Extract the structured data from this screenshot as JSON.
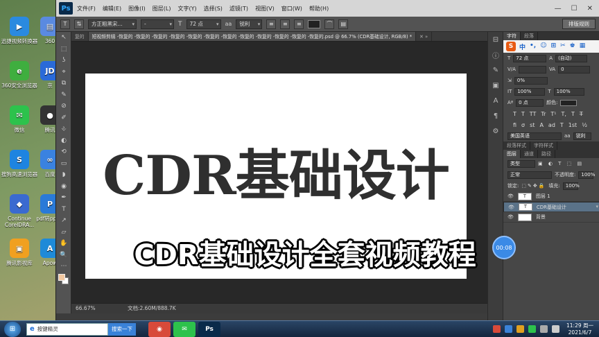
{
  "desktop": {
    "icons": [
      {
        "label": "迅捷视频转换器",
        "color": "#2a8ae0",
        "glyph": "▶"
      },
      {
        "label": "360安全浏览器",
        "color": "#3fae3f",
        "glyph": "e"
      },
      {
        "label": "微信",
        "color": "#2dc24c",
        "glyph": "✉"
      },
      {
        "label": "搜狗高速浏览器",
        "color": "#1e84e0",
        "glyph": "S"
      },
      {
        "label": "Continue CorelDRA...",
        "color": "#3a6ad0",
        "glyph": "◆"
      },
      {
        "label": "腾讯影视库",
        "color": "#f0a020",
        "glyph": "▣"
      }
    ],
    "icons_col2": [
      {
        "label": "360",
        "color": "#5a8ae0",
        "glyph": "▤"
      },
      {
        "label": "京",
        "color": "#2a6ad8",
        "glyph": "JD"
      },
      {
        "label": "腾讯",
        "color": "#333333",
        "glyph": "●"
      },
      {
        "label": "百度",
        "color": "#3a82e0",
        "glyph": "∞"
      },
      {
        "label": "pdf转ppt转",
        "color": "#2a7ad8",
        "glyph": "P"
      },
      {
        "label": "Apow",
        "color": "#1e8ad8",
        "glyph": "A"
      }
    ]
  },
  "photoshop": {
    "logo": "Ps",
    "menu": [
      "文件(F)",
      "编辑(E)",
      "图像(I)",
      "图层(L)",
      "文字(Y)",
      "选择(S)",
      "滤镜(T)",
      "视图(V)",
      "窗口(W)",
      "帮助(H)"
    ],
    "window_buttons": [
      "—",
      "☐",
      "✕"
    ],
    "options": {
      "tool_icon": "T",
      "orient_icon": "⇅",
      "font_family": "方正粗黑宋...",
      "font_style": "-",
      "size_icon": "T",
      "font_size": "72 点",
      "aa_label": "aa",
      "antialias": "锐利",
      "align_buttons": [
        "≡",
        "≡",
        "≡"
      ],
      "warp_icon": "⌒",
      "panel_icon": "▤",
      "preset": "排版规则"
    },
    "tabs": [
      {
        "label": "复的",
        "active": false
      },
      {
        "label": "短视频剪辑 -恢复的 -恢复的 -恢复的 -恢复的 -恢复的 -恢复的 -恢复的 -恢复的 -恢复的 -恢复的 -恢复的 -恢复的.psd @ 66.7% (CDR基础设计, RGB/8) *",
        "active": true
      },
      {
        "label": "✕ »",
        "active": false
      }
    ],
    "canvas_text": "CDR基础设计",
    "status": {
      "zoom": "66.67%",
      "doc": "文档:2.60M/888.7K"
    },
    "tools": [
      "↖",
      "⬚",
      "ʖ",
      "⌖",
      "⧉",
      "✎",
      "⊘",
      "✐",
      "⎀",
      "◐",
      "⟲",
      "▭",
      "◗",
      "◉",
      "✒",
      "T",
      "↗",
      "▱",
      "✋",
      "🔍",
      "⋯"
    ]
  },
  "subtitle": "CDR基础设计全套视频教程",
  "panels": {
    "char_tabs": [
      "字符",
      "段落"
    ],
    "sogou": {
      "logo": "S",
      "items": [
        "中",
        "•,",
        "☺",
        "⊞",
        "✂",
        "♚",
        "▦"
      ]
    },
    "size": "72 点",
    "leading": "(自动)",
    "kerning": "V/A",
    "tracking": "0",
    "scale_label": "0%",
    "vscale": "100%",
    "hscale": "100%",
    "baseline": "0 点",
    "color_label": "颜色:",
    "type_buttons": [
      "T",
      "T",
      "TT",
      "Tr",
      "T¹",
      "T,",
      "T",
      "T̶"
    ],
    "extra_buttons": [
      "fi",
      "σ",
      "st",
      "A",
      "ad",
      "T",
      "1st",
      "½"
    ],
    "language": "美国英语",
    "aa": "锐利",
    "para_tabs": [
      "段落样式",
      "字符样式"
    ],
    "layer_tabs": [
      "图层",
      "通道",
      "路径"
    ],
    "kind": "类型",
    "blend": "正常",
    "opacity_label": "不透明度:",
    "opacity": "100%",
    "lock_label": "锁定:",
    "fill_label": "填充:",
    "fill": "100%",
    "layers": [
      {
        "name": "图层 1",
        "thumb": "T",
        "selected": false
      },
      {
        "name": "CDR基础设计",
        "thumb": "T",
        "selected": true
      },
      {
        "name": "背景",
        "thumb": "",
        "selected": false
      }
    ],
    "timer": "00:08"
  },
  "taskbar": {
    "start": "⊞",
    "search_placeholder": "按键精灵",
    "search_button": "搜索一下",
    "apps": [
      {
        "name": "chrome",
        "color": "#d84a3a",
        "glyph": "◉"
      },
      {
        "name": "wechat",
        "color": "#2dc24c",
        "glyph": "✉"
      },
      {
        "name": "photoshop",
        "color": "#0a2a4a",
        "glyph": "Ps"
      }
    ],
    "time": "11:29 周一",
    "date": "2021/6/7"
  }
}
